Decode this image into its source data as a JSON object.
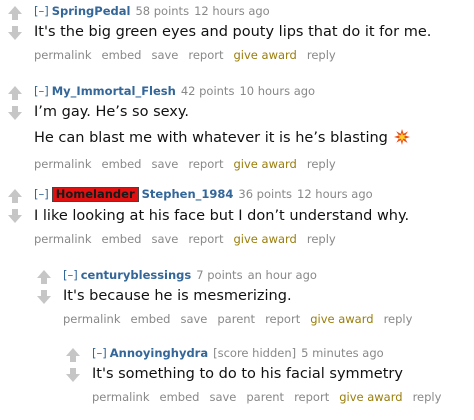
{
  "icons": {
    "upvote": "upvote-arrow-icon",
    "downvote": "downvote-arrow-icon",
    "explosion": "collision-emoji-icon"
  },
  "colors": {
    "author": "#336699",
    "meta": "#888888",
    "give_award": "#9a7d0a",
    "flair_bg": "#e01010",
    "vote_arrow": "#c6c6c6"
  },
  "comments": [
    {
      "expand": "[–]",
      "author": "SpringPedal",
      "score": "58 points",
      "time": "12 hours ago",
      "lines": [
        "It's the big green eyes and pouty lips that do it for me."
      ],
      "buttons": [
        "permalink",
        "embed",
        "save",
        "report",
        "give award",
        "reply"
      ]
    },
    {
      "expand": "[–]",
      "author": "My_Immortal_Flesh",
      "score": "42 points",
      "time": "10 hours ago",
      "lines": [
        "I’m gay. He’s so sexy.",
        "He can blast me with whatever it is he’s blasting"
      ],
      "buttons": [
        "permalink",
        "embed",
        "save",
        "report",
        "give award",
        "reply"
      ]
    },
    {
      "expand": "[–]",
      "flair": "Homelander",
      "author": "Stephen_1984",
      "score": "36 points",
      "time": "12 hours ago",
      "lines": [
        "I like looking at his face but I don’t understand why."
      ],
      "buttons": [
        "permalink",
        "embed",
        "save",
        "report",
        "give award",
        "reply"
      ]
    },
    {
      "expand": "[–]",
      "author": "centuryblessings",
      "score": "7 points",
      "time": "an hour ago",
      "lines": [
        "It's because he is mesmerizing."
      ],
      "buttons": [
        "permalink",
        "embed",
        "save",
        "parent",
        "report",
        "give award",
        "reply"
      ]
    },
    {
      "expand": "[–]",
      "author": "Annoyinghydra",
      "score": "[score hidden]",
      "time": "5 minutes ago",
      "lines": [
        "It's something to do to his facial symmetry"
      ],
      "buttons": [
        "permalink",
        "embed",
        "save",
        "parent",
        "report",
        "give award",
        "reply"
      ]
    }
  ]
}
